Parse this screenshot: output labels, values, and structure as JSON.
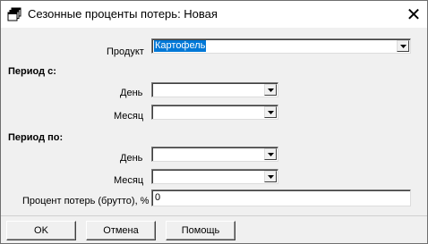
{
  "window": {
    "title": "Сезонные проценты потерь: Новая",
    "icon": "stacked-windows-icon",
    "close": "✕"
  },
  "form": {
    "product": {
      "label": "Продукт",
      "value": "Картофель"
    },
    "period_from": {
      "heading": "Период с:",
      "day_label": "День",
      "day_value": "",
      "month_label": "Месяц",
      "month_value": ""
    },
    "period_to": {
      "heading": "Период по:",
      "day_label": "День",
      "day_value": "",
      "month_label": "Месяц",
      "month_value": ""
    },
    "loss_percent": {
      "label": "Процент потерь (брутто), %",
      "value": "0"
    }
  },
  "buttons": {
    "ok": "OK",
    "cancel": "Отмена",
    "help": "Помощь"
  },
  "colors": {
    "selection": "#0078d7",
    "dialog_bg": "#f0f0f0"
  }
}
